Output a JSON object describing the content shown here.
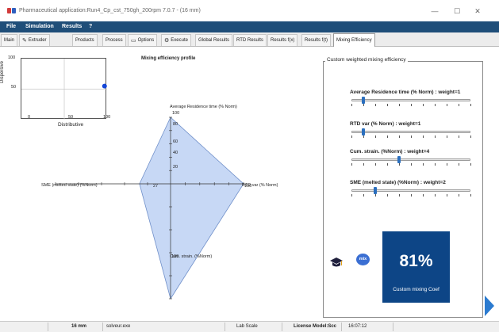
{
  "window": {
    "title": "Pharmaceutical application:Run4_Cp_cst_750gh_200rpm 7.0.7 - (16 mm)",
    "minimize_glyph": "—",
    "maximize_glyph": "☐",
    "close_glyph": "✕"
  },
  "menu": [
    "File",
    "Simulation",
    "Results",
    "?"
  ],
  "tabs": [
    {
      "label": "Main",
      "icon": ""
    },
    {
      "label": "Extruder",
      "icon": "extruder-icon"
    },
    {
      "label": "Products",
      "icon": ""
    },
    {
      "label": "Process",
      "icon": ""
    },
    {
      "label": "Options",
      "icon": "options-icon"
    },
    {
      "label": "Execute",
      "icon": "execute-icon"
    },
    {
      "label": "Global Results",
      "icon": ""
    },
    {
      "label": "RTD Results",
      "icon": ""
    },
    {
      "label": "Results f(x)",
      "icon": ""
    },
    {
      "label": "Results f(t)",
      "icon": ""
    },
    {
      "label": "Mixing Efficiency",
      "icon": "",
      "active": true
    }
  ],
  "scatter_plot": {
    "ylabel": "Dispersive",
    "xlabel": "Distributive",
    "yticks": [
      "100",
      "50"
    ],
    "xticks": [
      "0",
      "50",
      "100"
    ]
  },
  "radar_plot": {
    "title": "Mixing efficiency profile",
    "axis_labels": {
      "top": "Average Residence time (% Norm)",
      "right": "RTD var (% Norm)",
      "bottom": "Cum. strain. (%Norm)",
      "left": "SME (melted state) (%Norm)"
    },
    "ticks": [
      "100",
      "80",
      "60",
      "40",
      "20"
    ],
    "top_value_label": "100",
    "right_value_label": "100",
    "bottom_value_label": "100",
    "left_value_label": "27"
  },
  "chart_data": [
    {
      "type": "scatter",
      "xlabel": "Distributive",
      "ylabel": "Dispersive",
      "xlim": [
        0,
        100
      ],
      "ylim": [
        0,
        100
      ],
      "points": [
        {
          "x": 97,
          "y": 55
        }
      ],
      "grid": true
    },
    {
      "type": "radar",
      "title": "Mixing efficiency profile",
      "axes": [
        "Average Residence time (% Norm)",
        "RTD var (% Norm)",
        "Cum. strain. (%Norm)",
        "SME (melted state) (%Norm)"
      ],
      "values": [
        100,
        100,
        100,
        27
      ],
      "range": [
        0,
        100
      ],
      "fill_color": "#c7d8f5"
    }
  ],
  "panel": {
    "legend": "Custom weighted mixing efficiency",
    "sliders": [
      {
        "label": "Average Residence time (% Norm) : weight=1",
        "weight": 1
      },
      {
        "label": "RTD var (% Norm) : weight=1",
        "weight": 1
      },
      {
        "label": "Cum. strain. (%Norm) : weight=4",
        "weight": 4
      },
      {
        "label": "SME (melted state) (%Norm) : weight=2",
        "weight": 2
      }
    ],
    "slider_max": 10,
    "mix_badge": "mix",
    "coef_value": "81%",
    "coef_caption": "Custom mixing Coef"
  },
  "status": {
    "diameter": "16 mm",
    "executable": "solveur.exe",
    "scale": "Lab Scale",
    "license": "License Model:Scc",
    "time": "16:07:12"
  },
  "colors": {
    "menu_bg": "#1f4e79",
    "coef_bg": "#0d4586",
    "radar_fill": "#c7d8f5",
    "point": "#1446d8"
  }
}
